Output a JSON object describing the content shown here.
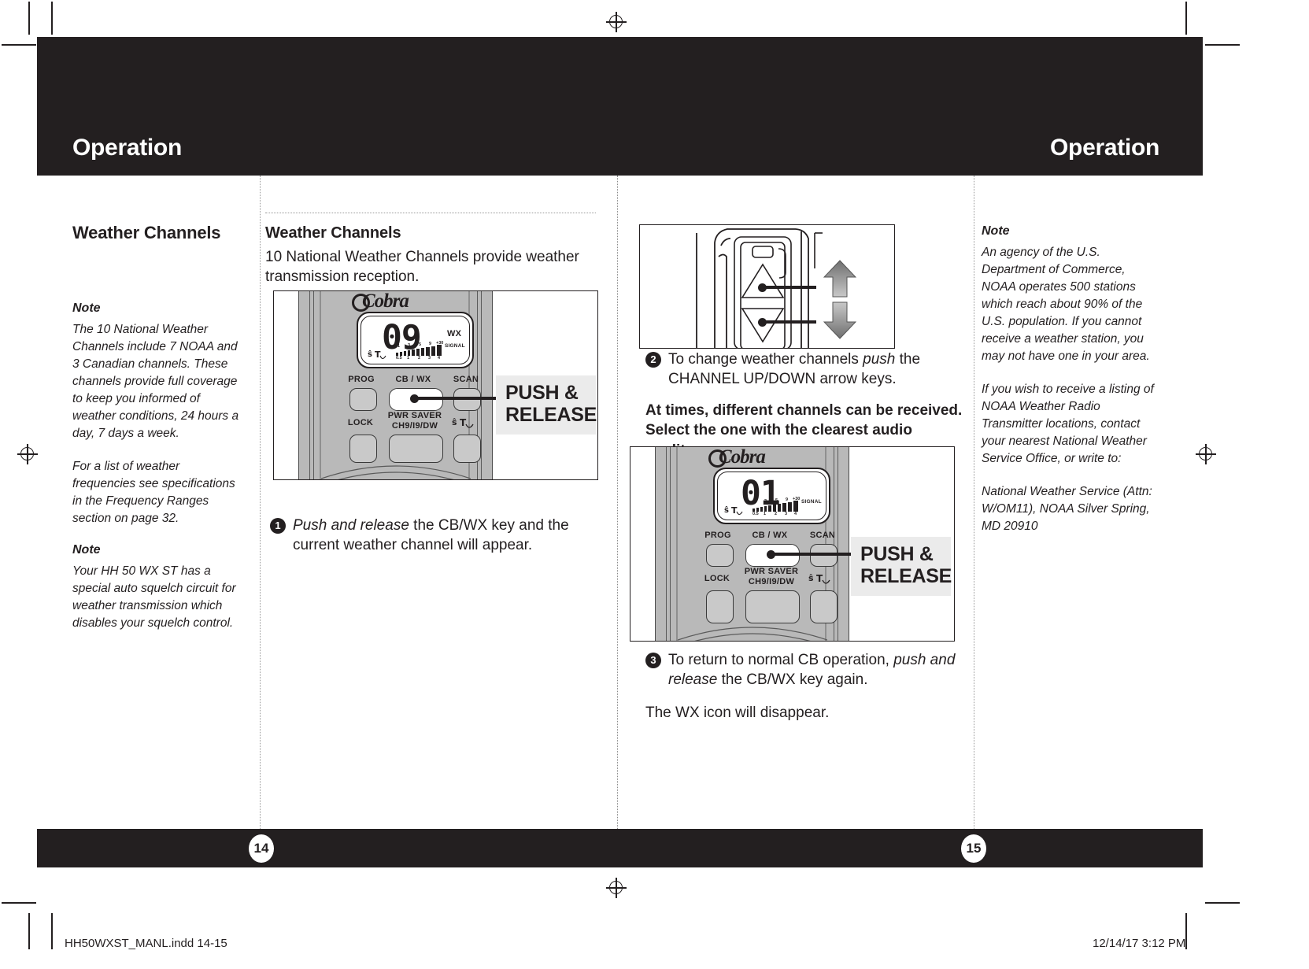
{
  "header": {
    "title_left": "Operation",
    "title_right": "Operation"
  },
  "footer": {
    "page_left": "14",
    "page_right": "15",
    "imprint_file": "HH50WXST_MANL.indd   14-15",
    "imprint_date": "12/14/17   3:12 PM"
  },
  "left_sidebar": {
    "heading": "Weather Channels",
    "notes": [
      {
        "label": "Note",
        "paragraphs": [
          "The 10 National Weather Channels include 7 NOAA and 3 Canadian channels. These channels provide full coverage to keep you informed of  weather conditions, 24 hours a day, 7 days a week.",
          "For a list of weather frequencies see specifications in the Frequency Ranges section on page 32."
        ]
      },
      {
        "label": "Note",
        "paragraphs": [
          "Your HH 50 WX ST has a special auto squelch circuit for weather transmission which disables your squelch control."
        ]
      }
    ]
  },
  "left_column": {
    "heading": "Weather Channels",
    "intro": "10 National Weather Channels provide weather transmission reception.",
    "figure": {
      "brand": "Cobra",
      "channel": "09",
      "wx_indicator": "WX",
      "signal_label": "SIGNAL",
      "scale_top": [
        "1",
        "3",
        "5",
        "9",
        "+30"
      ],
      "scale_bottom": [
        "0.5",
        "1",
        "2",
        "3",
        "4"
      ],
      "keys": [
        "PROG",
        "CB / WX",
        "SCAN",
        "LOCK",
        "PWR SAVER",
        "CH9/I9/DW"
      ],
      "callout_line1": "PUSH &",
      "callout_line2": "RELEASE"
    },
    "step": {
      "number": "1",
      "text_italic": "Push and release",
      "text_rest": " the CB/WX key and the current weather channel will appear."
    }
  },
  "right_column": {
    "figure_top": {
      "alt": "side view of radio with channel up and down arrow keys"
    },
    "step2": {
      "number": "2",
      "text_pre": "To change weather channels ",
      "text_italic": "push",
      "text_post": " the CHANNEL UP/DOWN arrow keys."
    },
    "bold_note": "At times, different channels can be received. Select the one with the clearest audio quality.",
    "figure_bottom": {
      "brand": "Cobra",
      "channel": "01",
      "signal_label": "SIGNAL",
      "scale_top": [
        "1",
        "3",
        "5",
        "9",
        "+30"
      ],
      "scale_bottom": [
        "0.5",
        "1",
        "2",
        "3",
        "4"
      ],
      "keys": [
        "PROG",
        "CB / WX",
        "SCAN",
        "LOCK",
        "PWR SAVER",
        "CH9/I9/DW"
      ],
      "callout_line1": "PUSH &",
      "callout_line2": "RELEASE"
    },
    "step3": {
      "number": "3",
      "text_pre": "To return to normal CB operation, ",
      "text_italic": "push and release",
      "text_post": " the CB/WX key again."
    },
    "closing": "The WX icon will disappear."
  },
  "right_sidebar": {
    "notes": [
      {
        "label": "Note",
        "paragraphs": [
          "An agency of the U.S. Department of Commerce, NOAA operates 500 stations which reach about 90% of the U.S. population. If you cannot receive a weather station, you may not have one in your area.",
          "If you wish to receive a listing of NOAA Weather Radio Transmitter locations, contact your nearest National Weather Service Office, or write to:",
          "National Weather Service (Attn: W/OM11), NOAA Silver Spring, MD 20910"
        ]
      }
    ]
  },
  "colors": {
    "ink": "#231f20",
    "paper": "#ffffff",
    "callout_bg": "#ebebeb",
    "device_gray": "#b9b9b9"
  }
}
